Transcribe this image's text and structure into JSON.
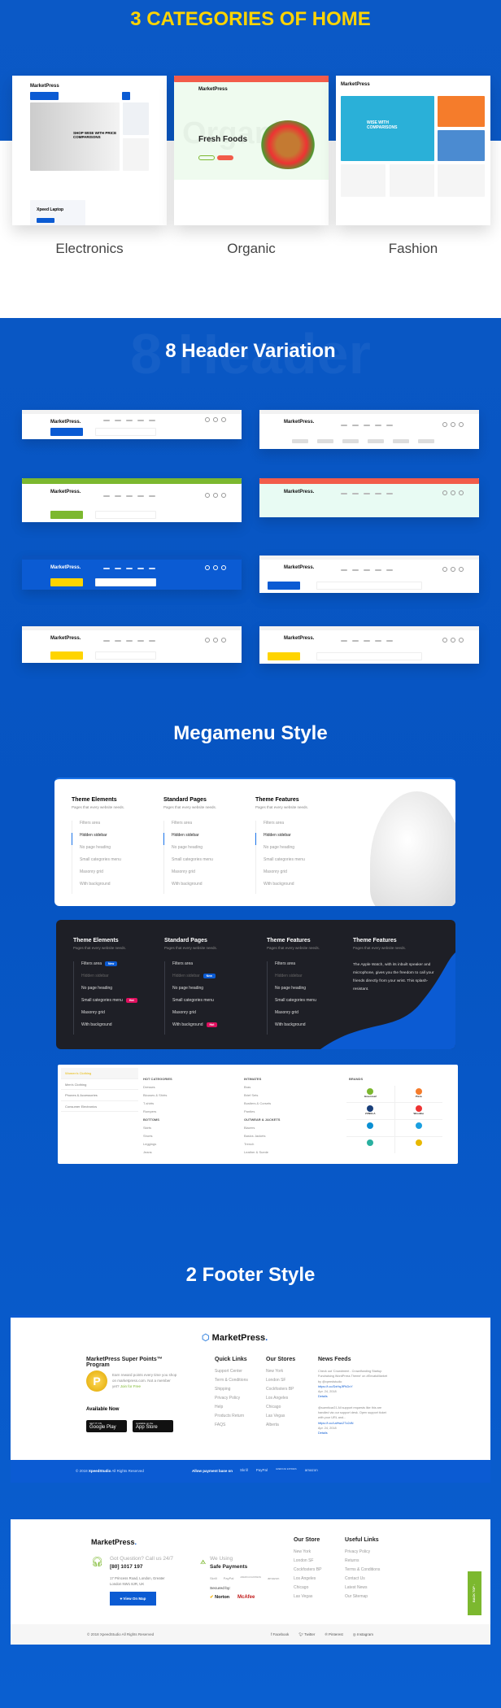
{
  "categories": {
    "title": "3 CATEGORIES OF HOME",
    "items": [
      {
        "label": "Electronics",
        "hero": "SHOP WISE WITH PRICE COMPARISONS",
        "brand": "MarketPress",
        "product": "Xpeed Laptop"
      },
      {
        "label": "Organic",
        "hero": "Fresh Foods",
        "brand": "MarketPress",
        "watermark": "Organic"
      },
      {
        "label": "Fashion",
        "hero": "WISE WITH COMPARISONS",
        "brand": "MarketPress"
      }
    ]
  },
  "headers": {
    "title": "8 Header Variation",
    "watermark": "8 Header",
    "logo": "MarketPress.",
    "variants": [
      {
        "accent": "#0b5bd3",
        "top": "#ffffff"
      },
      {
        "accent": "#0b5bd3",
        "top": "#ffffff"
      },
      {
        "accent": "#7cb82f",
        "top": "#7cb82f"
      },
      {
        "accent": "#f25c4a",
        "top": "#f25c4a"
      },
      {
        "accent": "#ffd400",
        "top": "#0b5bd3"
      },
      {
        "accent": "#0b5bd3",
        "top": "#ffffff"
      },
      {
        "accent": "#ffd400",
        "top": "#ffffff"
      },
      {
        "accent": "#ffd400",
        "top": "#ffffff"
      }
    ]
  },
  "megamenu": {
    "title": "Megamenu Style",
    "light": {
      "columns": [
        {
          "title": "Theme Elements",
          "sub": "Pages that every website needs."
        },
        {
          "title": "Standard Pages",
          "sub": "Pages that every website needs."
        },
        {
          "title": "Theme Features",
          "sub": "Pages that every website needs."
        }
      ],
      "items": [
        "Filters area",
        "Hidden sidebar",
        "No page heading",
        "Small categories menu",
        "Masonry grid",
        "With background"
      ]
    },
    "dark": {
      "columns": [
        {
          "title": "Theme Elements",
          "sub": "Pages that every website needs.",
          "items": [
            "Filters area",
            "Hidden sidebar",
            "No page heading",
            "Small categories menu",
            "Masonry grid",
            "With background"
          ],
          "badges": {
            "0": "New",
            "3": "Hot"
          }
        },
        {
          "title": "Standard Pages",
          "sub": "Pages that every website needs.",
          "items": [
            "Filters area",
            "Hidden sidebar",
            "No page heading",
            "Small categories menu",
            "Masonry grid",
            "With background"
          ],
          "badges": {
            "1": "New",
            "5": "Hot"
          }
        },
        {
          "title": "Theme Features",
          "sub": "Pages that every website needs.",
          "items": [
            "Filters area",
            "Hidden sidebar",
            "No page heading",
            "Small categories menu",
            "Masonry grid",
            "With background"
          ]
        }
      ],
      "feature": {
        "title": "Theme Features",
        "sub": "Pages that every website needs.",
        "text": "The Apple Watch, with its inbuilt speaker and microphone, gives you the freedom to call your friends directly from your wrist. This splash-resistant."
      }
    },
    "fashion": {
      "side": [
        "Women's Clothing",
        "Men's Clothing",
        "Phones & Accessories",
        "Consumer Electronics"
      ],
      "col1": [
        {
          "h": "HOT CATEGORIES",
          "items": [
            "Dresses",
            "Blouses & Shirts",
            "T-shirts",
            "Rompers"
          ]
        },
        {
          "h": "BOTTOMS",
          "items": [
            "Skirts",
            "Shorts",
            "Leggings",
            "Jeans"
          ]
        }
      ],
      "col2": [
        {
          "h": "INTIMATES",
          "items": [
            "Bras",
            "Brief Sets",
            "Bustiers & Corsets",
            "Panties"
          ]
        },
        {
          "h": "OUTWEAR & JACKETS",
          "items": [
            "Blazers",
            "Basics Jackets",
            "Trench",
            "Leather & Suede"
          ]
        }
      ],
      "brands_title": "BRANDS",
      "brands": [
        "Green leaf",
        "Pizza",
        "ZUNGLA",
        "Woodine",
        "",
        "",
        "",
        ""
      ]
    }
  },
  "footers": {
    "title": "2 Footer Style",
    "one": {
      "logo": "MarketPress",
      "points_title": "MarketPress Super Points™ Program",
      "points_text": "Earn reward points every time you shop on marketpress.com. Not a member yet?",
      "join": "Join for Free",
      "available": "Available Now",
      "google": "Google Play",
      "google_small": "GET IT ON",
      "apple": "App Store",
      "apple_small": "Available on the",
      "cols": [
        {
          "title": "Quick Links",
          "items": [
            "Support Center",
            "Term & Conditions",
            "Shipping",
            "Privacy Policy",
            "Help",
            "Products Return",
            "FAQS"
          ]
        },
        {
          "title": "Our Stores",
          "items": [
            "New York",
            "London SF",
            "Cockfosters BP",
            "Los Angeles",
            "Chicago",
            "Las Vegas",
            "Alberta"
          ]
        }
      ],
      "news_title": "News Feeds",
      "news": [
        {
          "text": "Check out 'Crowdment - Crowdfunding Startup Fundraising WordPress Theme' on #EnvatoMarket by @xpeedstudio",
          "link": "https://t.co/DxHqJfPkDvY",
          "date": "Apr. 24, 2018",
          "details": "Details"
        },
        {
          "text": "@suenticar21 All support requests like this are handled via our support desk. Open support ticket with your URL and...",
          "link": "https://t.co/LaHwc2Tz2dN",
          "date": "Apr. 24, 2018",
          "details": "Details"
        }
      ],
      "copyright_pre": "© 2018",
      "copyright_brand": "XpeedStudio",
      "copyright_post": "All Rights Reserved",
      "payment_label": "Allow payment base on",
      "payments": [
        "Skrill",
        "PayPal",
        "AMERICAN EXPRESS",
        "amazon"
      ]
    },
    "two": {
      "logo": "MarketPress",
      "call_title": "Got Question? Call us 24/7",
      "phone": "[80] 1017 197",
      "address": "17 Princess Road, London, Greater London NW1 8JR, UK",
      "map_button": "View On Map",
      "pay_title": "We Using",
      "pay_strong": "Safe Payments",
      "payments": [
        "Skrill",
        "PayPal",
        "AMERICAN EXPRESS",
        "amazon"
      ],
      "secured": "Secured by:",
      "norton": "Norton",
      "mcafee": "McAfee",
      "cols": [
        {
          "title": "Our Store",
          "items": [
            "New York",
            "London SF",
            "Cockfosters BP",
            "Los Angeles",
            "Chicago",
            "Las Vegas"
          ]
        },
        {
          "title": "Useful Links",
          "items": [
            "Privacy Policy",
            "Returns",
            "Terms & Conditions",
            "Contact Us",
            "Latest News",
            "Our Sitemap"
          ]
        }
      ],
      "back_top": "BACK TOP",
      "copyright": "© 2018 XpeedStudio All Rights Reserved",
      "social": [
        "Facebook",
        "Twitter",
        "Pinterest",
        "Instagram"
      ]
    }
  },
  "colors": {
    "blue": "#0b5bd3",
    "yellow": "#ffd400",
    "dark": "#1e1f26",
    "green": "#7cb82f",
    "hot": "#e0105f"
  }
}
